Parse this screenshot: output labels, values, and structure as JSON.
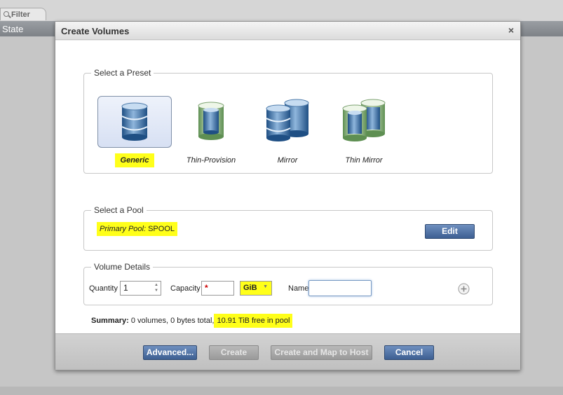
{
  "background": {
    "filter_tab": "Filter",
    "header_col": "State"
  },
  "dialog": {
    "title": "Create Volumes",
    "close_glyph": "×",
    "preset_group": {
      "legend": "Select a Preset",
      "presets": [
        {
          "label": "Generic",
          "selected": true,
          "icon": "database-icon"
        },
        {
          "label": "Thin-Provision",
          "selected": false,
          "icon": "thin-database-icon"
        },
        {
          "label": "Mirror",
          "selected": false,
          "icon": "mirror-database-icon"
        },
        {
          "label": "Thin Mirror",
          "selected": false,
          "icon": "thin-mirror-database-icon"
        }
      ]
    },
    "pool_group": {
      "legend": "Select a Pool",
      "pool_label": "Primary Pool:",
      "pool_value": "SPOOL",
      "edit_label": "Edit"
    },
    "details_group": {
      "legend": "Volume Details",
      "quantity_label": "Quantity",
      "quantity_value": "1",
      "capacity_label": "Capacity",
      "capacity_required": "*",
      "unit_value": "GiB",
      "name_label": "Name",
      "name_value": ""
    },
    "summary": {
      "label": "Summary:",
      "text": "0 volumes, 0 bytes total,",
      "free": "10.91 TiB free in pool"
    },
    "buttons": {
      "advanced": "Advanced...",
      "create": "Create",
      "create_map": "Create and Map to Host",
      "cancel": "Cancel"
    }
  },
  "colors": {
    "highlight": "#ffff1a",
    "button_blue": "#3d5f92",
    "required_red": "#cc0000"
  }
}
